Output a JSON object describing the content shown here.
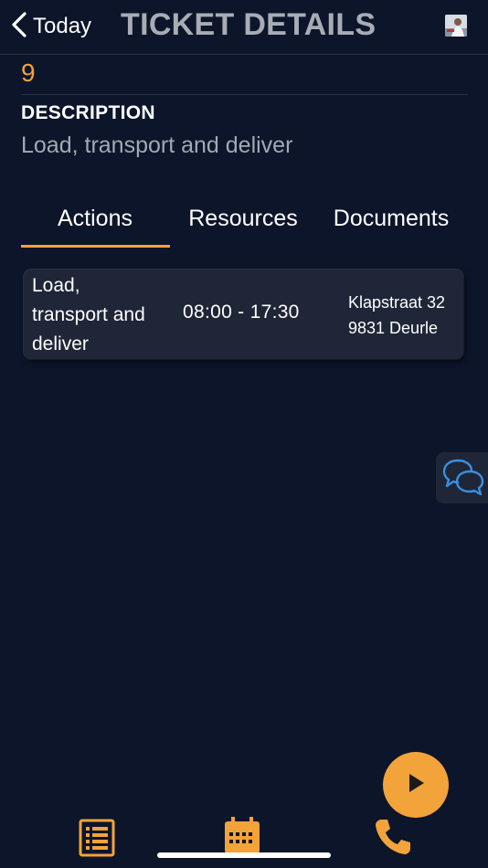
{
  "header": {
    "back_label": "Today",
    "title": "TICKET DETAILS"
  },
  "ticket": {
    "number": "9",
    "description_label": "DESCRIPTION",
    "description": "Load, transport and deliver"
  },
  "tabs": [
    {
      "label": "Actions",
      "active": true
    },
    {
      "label": "Resources",
      "active": false
    },
    {
      "label": "Documents",
      "active": false
    }
  ],
  "actions": [
    {
      "name": "Load, transport and deliver",
      "time": "08:00 - 17:30",
      "address_line1": "Klapstraat 32",
      "address_line2": "9831 Deurle"
    }
  ],
  "icons": {
    "back": "chevron-left-icon",
    "avatar": "user-avatar",
    "chat": "chat-bubbles-icon",
    "play": "play-icon",
    "list": "list-icon",
    "calendar": "calendar-icon",
    "phone": "phone-icon"
  },
  "colors": {
    "background": "#0c1529",
    "accent": "#f2a33a",
    "card": "#1e2637",
    "title": "#a7acb5",
    "chat_icon": "#3a8fe0"
  }
}
